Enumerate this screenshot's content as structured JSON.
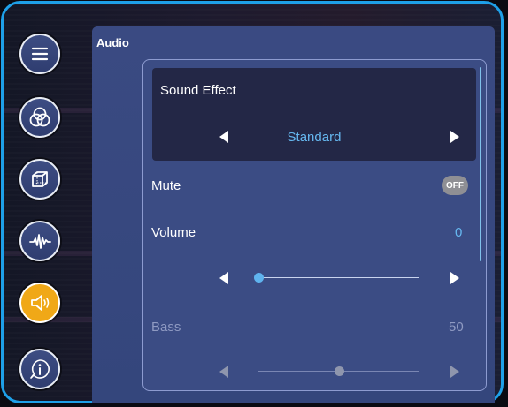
{
  "panel": {
    "title": "Audio"
  },
  "nav": [
    {
      "icon": "menu-icon",
      "active": false
    },
    {
      "icon": "color-circles-icon",
      "active": false
    },
    {
      "icon": "cube-icon",
      "active": false
    },
    {
      "icon": "waveform-icon",
      "active": false
    },
    {
      "icon": "speaker-icon",
      "active": true
    },
    {
      "icon": "info-icon",
      "active": false
    }
  ],
  "sound_effect": {
    "label": "Sound Effect",
    "value": "Standard"
  },
  "mute": {
    "label": "Mute",
    "state": "OFF"
  },
  "volume": {
    "label": "Volume",
    "value": "0",
    "level": 0
  },
  "bass": {
    "label": "Bass",
    "value": "50",
    "level": 0.5
  },
  "colors": {
    "accent": "#f0a817",
    "value_blue": "#66b8f0",
    "frame": "#1ea0e8"
  }
}
